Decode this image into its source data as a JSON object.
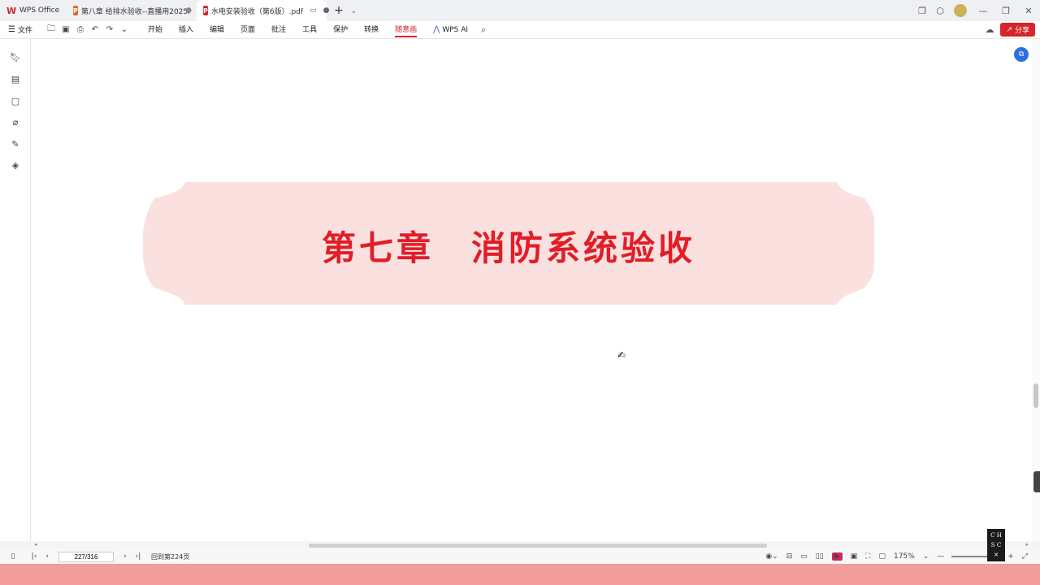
{
  "tabs": [
    {
      "label": "WPS Office",
      "icon": "W"
    },
    {
      "label": "第八章 给排水验收--直播用2025.",
      "icon": "P"
    },
    {
      "label": "水电安装验收（第6版）.pdf",
      "icon": "P"
    }
  ],
  "toolbar": {
    "file_label": "文件",
    "tabs": [
      "开始",
      "插入",
      "编辑",
      "页面",
      "批注",
      "工具",
      "保护",
      "转换",
      "随意画"
    ],
    "ai_label": "WPS AI",
    "share_label": "分享"
  },
  "document": {
    "chapter_title": "第七章　消防系统验收"
  },
  "status": {
    "page_field": "227/316",
    "goto_label": "回到第224页",
    "zoom": "175%"
  },
  "logo": {
    "line1": "C H",
    "line2": "S C"
  },
  "colors": {
    "accent": "#d4262b",
    "banner_fill": "#fbe0e0",
    "title_red": "#e11d26"
  }
}
